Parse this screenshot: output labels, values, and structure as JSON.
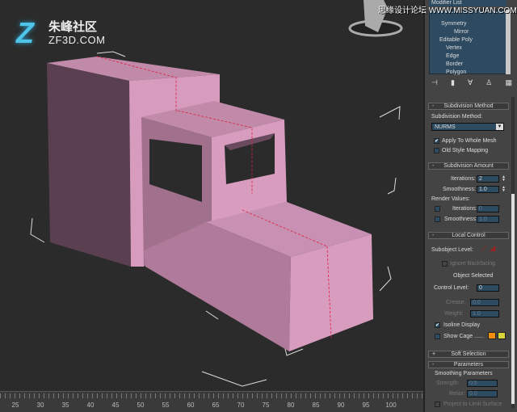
{
  "logo": {
    "glyph": "Z",
    "cn": "朱峰社区",
    "en": "ZF3D.COM"
  },
  "watermark": "思缘设计论坛 WWW.MISSYUAN.COM",
  "timeline": {
    "ticks": [
      "25",
      "30",
      "35",
      "40",
      "45",
      "50",
      "55",
      "60",
      "65",
      "70",
      "75",
      "80",
      "85",
      "90",
      "95",
      "100"
    ]
  },
  "panel": {
    "modifier_list": "Modifier List",
    "stack": [
      "Symmetry",
      "Mirror",
      "Editable Poly",
      "Vertex",
      "Edge",
      "Border",
      "Polygon"
    ],
    "subdiv_method": {
      "title": "Subdivision Method",
      "label": "Subdivision Method:",
      "value": "NURMS",
      "apply_whole": "Apply To Whole Mesh",
      "old_style": "Old Style Mapping"
    },
    "subdiv_amount": {
      "title": "Subdivision Amount",
      "iterations_label": "Iterations:",
      "iterations": "2",
      "smoothness_label": "Smoothness:",
      "smoothness": "1.0",
      "render_values": "Render Values:",
      "r_iterations_label": "Iterations:",
      "r_iterations": "0",
      "r_smoothness_label": "Smoothness:",
      "r_smoothness": "1.0"
    },
    "local_control": {
      "title": "Local Control",
      "subobject_label": "Subobject Level:",
      "ignore_backfacing": "Ignore Backfacing",
      "object_selected": "Object Selected",
      "control_level_label": "Control Level:",
      "control_level": "0",
      "crease_label": "Crease:",
      "crease": "0.0",
      "weight_label": "Weight:",
      "weight": "1.0",
      "isoline": "Isoline Display",
      "show_cage": "Show Cage ......",
      "cage_colors": [
        "#f0900a",
        "#d6d63a"
      ]
    },
    "soft_selection": "Soft Selection",
    "parameters": {
      "title": "Parameters",
      "smoothing": "Smoothing Parameters",
      "strength_label": "Strength:",
      "strength": "0.5",
      "relax_label": "Relax:",
      "relax": "0.0",
      "project": "Project to Limit Surface"
    }
  }
}
